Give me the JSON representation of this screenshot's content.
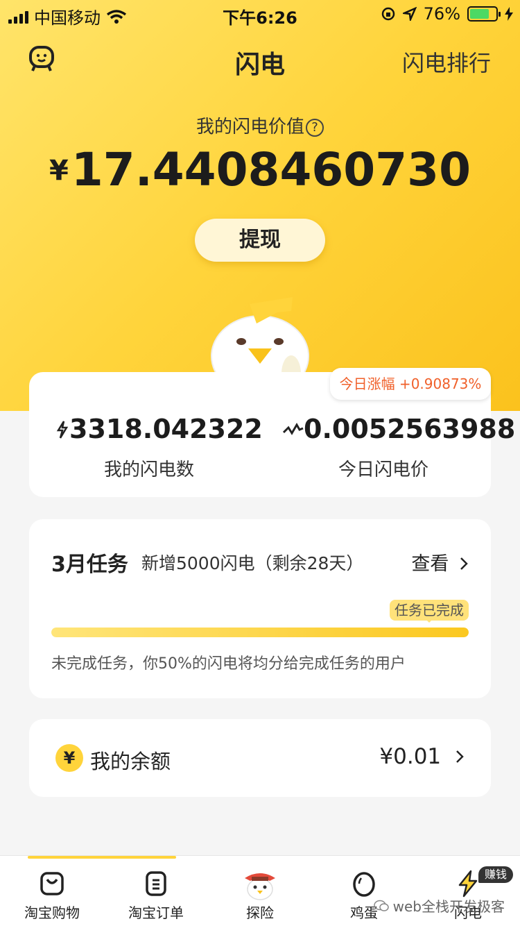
{
  "status": {
    "carrier": "中国移动",
    "time": "下午6:26",
    "battery": "76%",
    "battery_level": 0.76
  },
  "nav": {
    "title": "闪电",
    "rank": "闪电排行"
  },
  "value": {
    "label": "我的闪电价值",
    "currency": "¥",
    "amount": "17.4408460730",
    "help": "?"
  },
  "withdraw_label": "提现",
  "rise": "今日涨幅 +0.90873%",
  "stats": {
    "count": {
      "value": "3318.042322",
      "label": "我的闪电数"
    },
    "price": {
      "value": "0.0052563988",
      "label": "今日闪电价"
    }
  },
  "task": {
    "title": "3月任务",
    "desc": "新增5000闪电（剩余28天）",
    "view": "查看",
    "done_tag": "任务已完成",
    "progress": 1.0,
    "note": "未完成任务，你50%的闪电将均分给完成任务的用户"
  },
  "balance": {
    "icon": "¥",
    "label": "我的余额",
    "value": "¥0.01"
  },
  "tabs": [
    {
      "label": "淘宝购物",
      "icon": "bag-icon"
    },
    {
      "label": "淘宝订单",
      "icon": "order-icon"
    },
    {
      "label": "探险",
      "icon": "chick-hat-icon"
    },
    {
      "label": "鸡蛋",
      "icon": "egg-icon"
    },
    {
      "label": "闪电",
      "icon": "lightning-icon"
    }
  ],
  "earn_badge": "赚钱",
  "watermark": "web全栈开发极客",
  "colors": {
    "accent": "#ffd43b",
    "rise": "#f0602a"
  }
}
